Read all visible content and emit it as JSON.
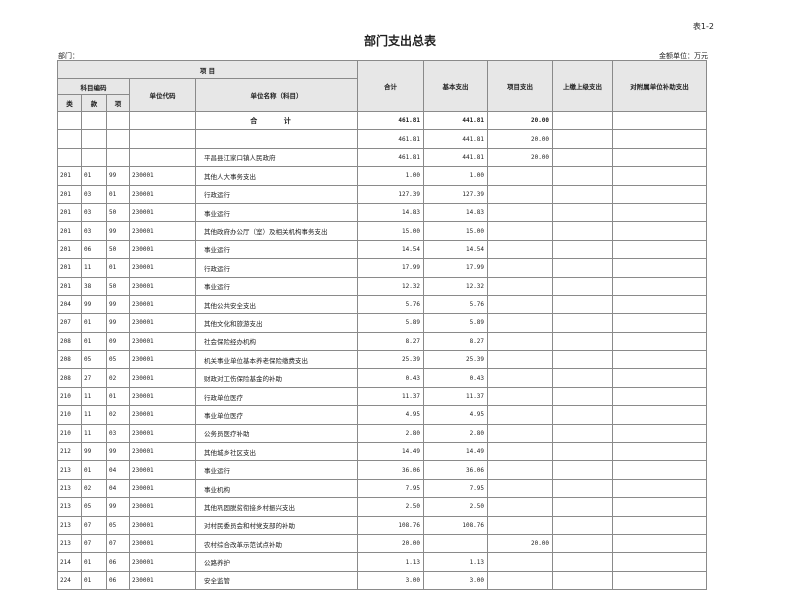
{
  "header": {
    "table_no": "表1-2",
    "title": "部门支出总表",
    "dept_label": "部门：",
    "unit_label": "金额单位：万元"
  },
  "columns": {
    "project": "项    目",
    "subject_code": "科目编码",
    "lei": "类",
    "kuan": "款",
    "xiang": "项",
    "unit_code": "单位代码",
    "unit_name": "单位名称（科目）",
    "total": "合计",
    "basic": "基本支出",
    "project_exp": "项目支出",
    "upper": "上缴上级支出",
    "subsidy": "对附属单位补助支出"
  },
  "totals": {
    "label": "合 计",
    "total": "461.81",
    "basic": "441.81",
    "project": "20.00"
  },
  "rows": [
    {
      "lei": "",
      "kuan": "",
      "xiang": "",
      "code": "",
      "name": "",
      "total": "461.81",
      "basic": "441.81",
      "project": "20.00"
    },
    {
      "lei": "",
      "kuan": "",
      "xiang": "",
      "code": "",
      "name": "平昌县江家口镇人民政府",
      "total": "461.81",
      "basic": "441.81",
      "project": "20.00"
    },
    {
      "lei": "201",
      "kuan": "01",
      "xiang": "99",
      "code": "230001",
      "name": "其他人大事务支出",
      "total": "1.00",
      "basic": "1.00",
      "project": ""
    },
    {
      "lei": "201",
      "kuan": "03",
      "xiang": "01",
      "code": "230001",
      "name": "行政运行",
      "total": "127.39",
      "basic": "127.39",
      "project": ""
    },
    {
      "lei": "201",
      "kuan": "03",
      "xiang": "50",
      "code": "230001",
      "name": "事业运行",
      "total": "14.83",
      "basic": "14.83",
      "project": ""
    },
    {
      "lei": "201",
      "kuan": "03",
      "xiang": "99",
      "code": "230001",
      "name": "其他政府办公厅（室）及相关机构事务支出",
      "total": "15.00",
      "basic": "15.00",
      "project": ""
    },
    {
      "lei": "201",
      "kuan": "06",
      "xiang": "50",
      "code": "230001",
      "name": "事业运行",
      "total": "14.54",
      "basic": "14.54",
      "project": ""
    },
    {
      "lei": "201",
      "kuan": "11",
      "xiang": "01",
      "code": "230001",
      "name": "行政运行",
      "total": "17.99",
      "basic": "17.99",
      "project": ""
    },
    {
      "lei": "201",
      "kuan": "38",
      "xiang": "50",
      "code": "230001",
      "name": "事业运行",
      "total": "12.32",
      "basic": "12.32",
      "project": ""
    },
    {
      "lei": "204",
      "kuan": "99",
      "xiang": "99",
      "code": "230001",
      "name": "其他公共安全支出",
      "total": "5.76",
      "basic": "5.76",
      "project": ""
    },
    {
      "lei": "207",
      "kuan": "01",
      "xiang": "99",
      "code": "230001",
      "name": "其他文化和旅游支出",
      "total": "5.89",
      "basic": "5.89",
      "project": ""
    },
    {
      "lei": "208",
      "kuan": "01",
      "xiang": "09",
      "code": "230001",
      "name": "社会保险经办机构",
      "total": "8.27",
      "basic": "8.27",
      "project": ""
    },
    {
      "lei": "208",
      "kuan": "05",
      "xiang": "05",
      "code": "230001",
      "name": "机关事业单位基本养老保险缴费支出",
      "total": "25.39",
      "basic": "25.39",
      "project": ""
    },
    {
      "lei": "208",
      "kuan": "27",
      "xiang": "02",
      "code": "230001",
      "name": "财政对工伤保险基金的补助",
      "total": "0.43",
      "basic": "0.43",
      "project": ""
    },
    {
      "lei": "210",
      "kuan": "11",
      "xiang": "01",
      "code": "230001",
      "name": "行政单位医疗",
      "total": "11.37",
      "basic": "11.37",
      "project": ""
    },
    {
      "lei": "210",
      "kuan": "11",
      "xiang": "02",
      "code": "230001",
      "name": "事业单位医疗",
      "total": "4.95",
      "basic": "4.95",
      "project": ""
    },
    {
      "lei": "210",
      "kuan": "11",
      "xiang": "03",
      "code": "230001",
      "name": "公务员医疗补助",
      "total": "2.80",
      "basic": "2.80",
      "project": ""
    },
    {
      "lei": "212",
      "kuan": "99",
      "xiang": "99",
      "code": "230001",
      "name": "其他城乡社区支出",
      "total": "14.49",
      "basic": "14.49",
      "project": ""
    },
    {
      "lei": "213",
      "kuan": "01",
      "xiang": "04",
      "code": "230001",
      "name": "事业运行",
      "total": "36.06",
      "basic": "36.06",
      "project": ""
    },
    {
      "lei": "213",
      "kuan": "02",
      "xiang": "04",
      "code": "230001",
      "name": "事业机构",
      "total": "7.95",
      "basic": "7.95",
      "project": ""
    },
    {
      "lei": "213",
      "kuan": "05",
      "xiang": "99",
      "code": "230001",
      "name": "其他巩固脱贫衔接乡村振兴支出",
      "total": "2.50",
      "basic": "2.50",
      "project": ""
    },
    {
      "lei": "213",
      "kuan": "07",
      "xiang": "05",
      "code": "230001",
      "name": "对村民委员会和村党支部的补助",
      "total": "108.76",
      "basic": "108.76",
      "project": ""
    },
    {
      "lei": "213",
      "kuan": "07",
      "xiang": "07",
      "code": "230001",
      "name": "农村综合改革示范试点补助",
      "total": "20.00",
      "basic": "",
      "project": "20.00"
    },
    {
      "lei": "214",
      "kuan": "01",
      "xiang": "06",
      "code": "230001",
      "name": "公路养护",
      "total": "1.13",
      "basic": "1.13",
      "project": ""
    },
    {
      "lei": "224",
      "kuan": "01",
      "xiang": "06",
      "code": "230001",
      "name": "安全监管",
      "total": "3.00",
      "basic": "3.00",
      "project": ""
    }
  ]
}
